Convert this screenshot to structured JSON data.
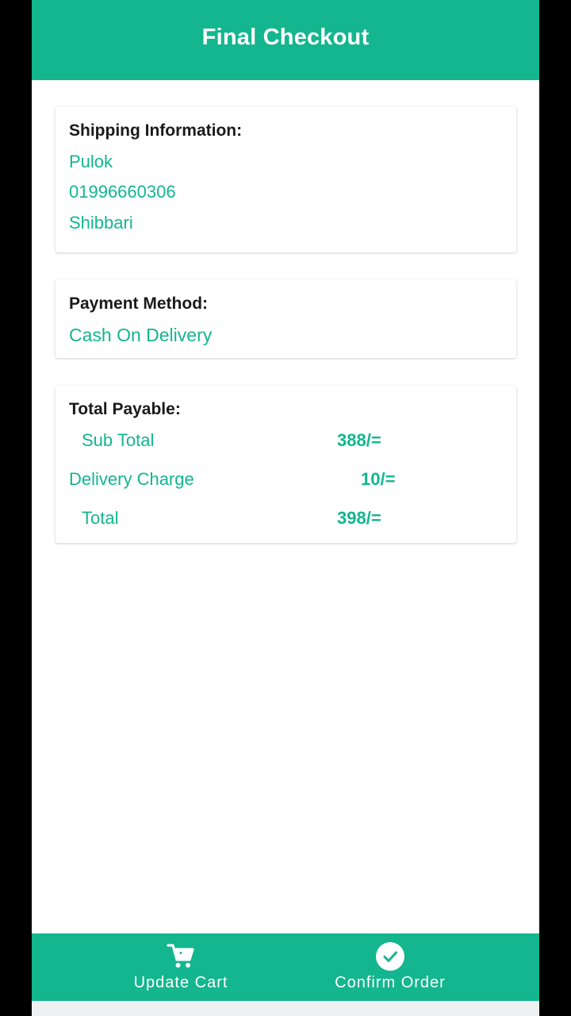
{
  "header": {
    "title": "Final Checkout"
  },
  "shipping": {
    "heading": "Shipping Information:",
    "name": "Pulok",
    "phone": "01996660306",
    "address": "Shibbari"
  },
  "payment": {
    "heading": "Payment Method:",
    "method": "Cash On Delivery"
  },
  "totals": {
    "heading": "Total Payable:",
    "rows": [
      {
        "label": "Sub Total",
        "value": "388/="
      },
      {
        "label": "Delivery Charge",
        "value": "10/="
      },
      {
        "label": "Total",
        "value": "398/="
      }
    ]
  },
  "bottom_nav": {
    "update_cart": {
      "label": "Update Cart",
      "icon": "cart-icon"
    },
    "confirm_order": {
      "label": "Confirm Order",
      "icon": "check-circle-icon"
    }
  },
  "colors": {
    "accent": "#13b68e",
    "background": "#ffffff"
  }
}
